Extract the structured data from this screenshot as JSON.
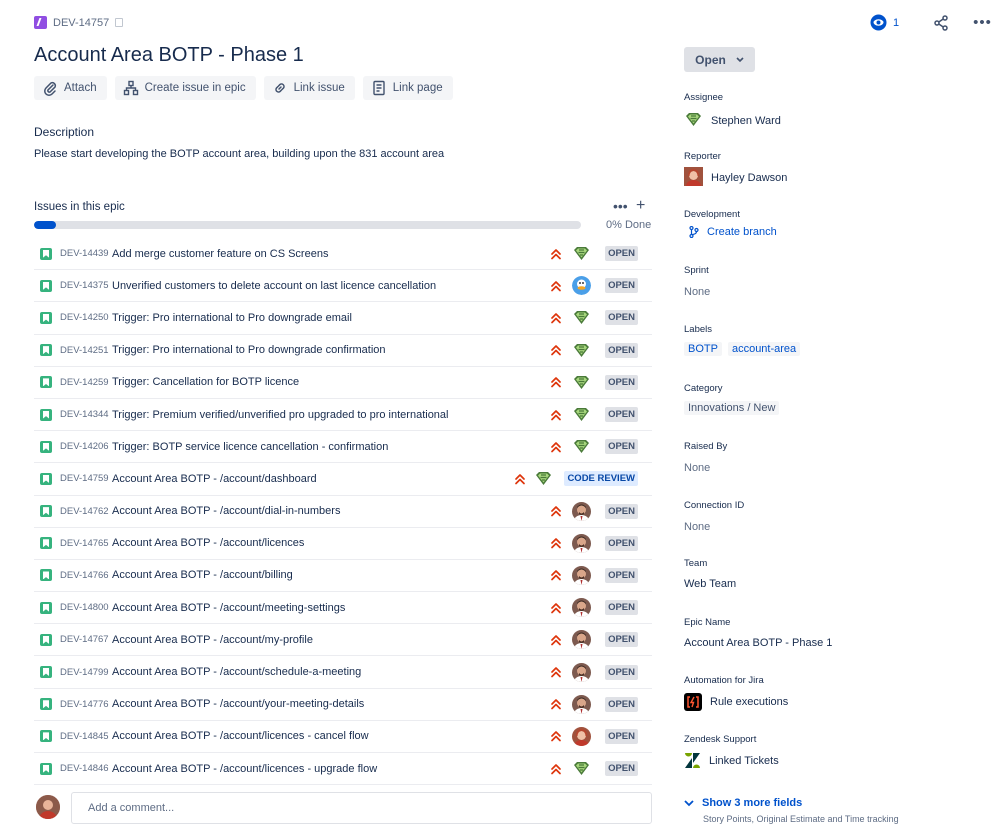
{
  "breadcrumb": {
    "issue_key": "DEV-14757"
  },
  "issue": {
    "title": "Account Area BOTP - Phase 1"
  },
  "toolbar": {
    "attach": "Attach",
    "create_issue_in_epic": "Create issue in epic",
    "link_issue": "Link issue",
    "link_page": "Link page"
  },
  "description": {
    "heading": "Description",
    "text": "Please start developing the BOTP account area, building upon the 831 account area"
  },
  "epic_issues": {
    "heading": "Issues in this epic",
    "progress_percent": 4,
    "progress_text": "0% Done",
    "items": [
      {
        "key": "DEV-14439",
        "summary": "Add merge customer feature on CS Screens",
        "priority": "highest",
        "assignee_avatar": "superman",
        "status": "OPEN"
      },
      {
        "key": "DEV-14375",
        "summary": "Unverified customers to delete account on last licence cancellation",
        "priority": "highest",
        "assignee_avatar": "donald",
        "status": "OPEN"
      },
      {
        "key": "DEV-14250",
        "summary": "Trigger: Pro international to Pro downgrade email",
        "priority": "highest",
        "assignee_avatar": "superman",
        "status": "OPEN"
      },
      {
        "key": "DEV-14251",
        "summary": "Trigger: Pro international to Pro downgrade confirmation",
        "priority": "highest",
        "assignee_avatar": "superman",
        "status": "OPEN"
      },
      {
        "key": "DEV-14259",
        "summary": "Trigger: Cancellation for BOTP licence",
        "priority": "highest",
        "assignee_avatar": "superman",
        "status": "OPEN"
      },
      {
        "key": "DEV-14344",
        "summary": "Trigger: Premium verified/unverified pro upgraded to pro international",
        "priority": "highest",
        "assignee_avatar": "superman",
        "status": "OPEN"
      },
      {
        "key": "DEV-14206",
        "summary": "Trigger: BOTP service licence cancellation - confirmation",
        "priority": "highest",
        "assignee_avatar": "superman",
        "status": "OPEN"
      },
      {
        "key": "DEV-14759",
        "summary": "Account Area BOTP - /account/dashboard",
        "priority": "highest",
        "assignee_avatar": "superman",
        "status": "CODE REVIEW"
      },
      {
        "key": "DEV-14762",
        "summary": "Account Area BOTP - /account/dial-in-numbers",
        "priority": "highest",
        "assignee_avatar": "man",
        "status": "OPEN"
      },
      {
        "key": "DEV-14765",
        "summary": "Account Area BOTP - /account/licences",
        "priority": "highest",
        "assignee_avatar": "man",
        "status": "OPEN"
      },
      {
        "key": "DEV-14766",
        "summary": "Account Area BOTP - /account/billing",
        "priority": "highest",
        "assignee_avatar": "man",
        "status": "OPEN"
      },
      {
        "key": "DEV-14800",
        "summary": "Account Area BOTP - /account/meeting-settings",
        "priority": "highest",
        "assignee_avatar": "man",
        "status": "OPEN"
      },
      {
        "key": "DEV-14767",
        "summary": "Account Area BOTP - /account/my-profile",
        "priority": "highest",
        "assignee_avatar": "man",
        "status": "OPEN"
      },
      {
        "key": "DEV-14799",
        "summary": "Account Area BOTP - /account/schedule-a-meeting",
        "priority": "highest",
        "assignee_avatar": "man",
        "status": "OPEN"
      },
      {
        "key": "DEV-14776",
        "summary": "Account Area BOTP - /account/your-meeting-details",
        "priority": "highest",
        "assignee_avatar": "man",
        "status": "OPEN"
      },
      {
        "key": "DEV-14845",
        "summary": "Account Area BOTP - /account/licences - cancel flow",
        "priority": "highest",
        "assignee_avatar": "woman",
        "status": "OPEN"
      },
      {
        "key": "DEV-14846",
        "summary": "Account Area BOTP - /account/licences - upgrade flow",
        "priority": "highest",
        "assignee_avatar": "superman",
        "status": "OPEN"
      }
    ]
  },
  "comment": {
    "placeholder": "Add a comment..."
  },
  "watchers": {
    "count": "1"
  },
  "status_button": {
    "label": "Open"
  },
  "details": {
    "assignee": {
      "label": "Assignee",
      "value": "Stephen Ward"
    },
    "reporter": {
      "label": "Reporter",
      "value": "Hayley Dawson"
    },
    "development": {
      "label": "Development",
      "value": "Create branch"
    },
    "sprint": {
      "label": "Sprint",
      "value": "None"
    },
    "labels": {
      "label": "Labels",
      "values": [
        "BOTP",
        "account-area"
      ]
    },
    "category": {
      "label": "Category",
      "value": "Innovations / New"
    },
    "raised_by": {
      "label": "Raised By",
      "value": "None"
    },
    "connection_id": {
      "label": "Connection ID",
      "value": "None"
    },
    "team": {
      "label": "Team",
      "value": "Web Team"
    },
    "epic_name": {
      "label": "Epic Name",
      "value": "Account Area BOTP - Phase 1"
    },
    "automation": {
      "label": "Automation for Jira",
      "value": "Rule executions"
    },
    "zendesk": {
      "label": "Zendesk Support",
      "value": "Linked Tickets"
    }
  },
  "show_more": {
    "label": "Show 3 more fields",
    "sub": "Story Points, Original Estimate and Time tracking"
  },
  "colors": {
    "brand_blue": "#0052cc",
    "epic_purple": "#904ee2",
    "story_green": "#36b37e",
    "priority_red": "#de350b"
  }
}
